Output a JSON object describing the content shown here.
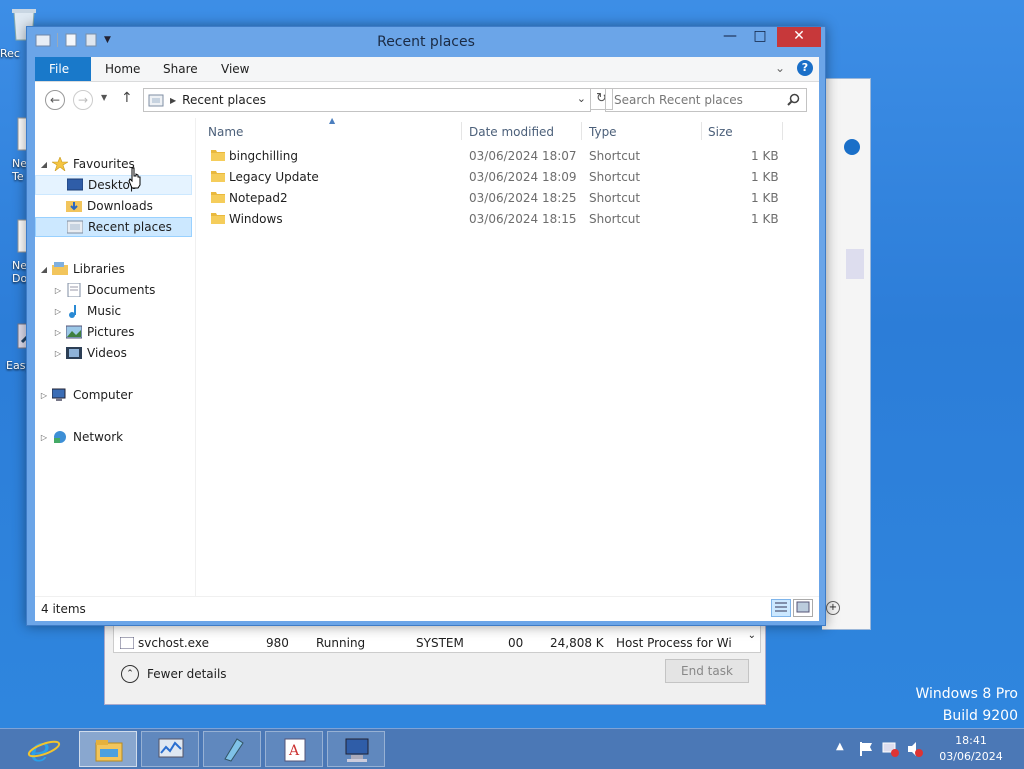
{
  "desktop": {
    "icons": [
      {
        "label": "Rec",
        "icon": "recycle-bin-icon"
      },
      {
        "label": "Ne\nTe",
        "icon": "text-document-icon"
      },
      {
        "label": "Ne\nDo",
        "icon": "document-icon"
      },
      {
        "label": "Easy",
        "icon": "shortcut-icon"
      }
    ],
    "watermark": {
      "line1": "Windows 8 Pro",
      "line2": "Build 9200"
    }
  },
  "task_manager": {
    "rows": [
      {
        "name": "svchost.exe",
        "pid": "980",
        "status": "Running",
        "user": "SYSTEM",
        "cpu": "00",
        "memory": "24,808 K",
        "description": "Host Process for Wi"
      }
    ],
    "fewer_details": "Fewer details",
    "end_task": "End task"
  },
  "explorer": {
    "title": "Recent places",
    "ribbon_tabs": [
      "File",
      "Home",
      "Share",
      "View"
    ],
    "address": "Recent places",
    "search_placeholder": "Search Recent places",
    "nav": {
      "favourites": "Favourites",
      "desktop": "Desktop",
      "downloads": "Downloads",
      "recent_places": "Recent places",
      "libraries": "Libraries",
      "documents": "Documents",
      "music": "Music",
      "pictures": "Pictures",
      "videos": "Videos",
      "computer": "Computer",
      "network": "Network"
    },
    "columns": {
      "name": "Name",
      "date": "Date modified",
      "type": "Type",
      "size": "Size"
    },
    "files": [
      {
        "name": "bingchilling",
        "date": "03/06/2024 18:07",
        "type": "Shortcut",
        "size": "1 KB"
      },
      {
        "name": "Legacy Update",
        "date": "03/06/2024 18:09",
        "type": "Shortcut",
        "size": "1 KB"
      },
      {
        "name": "Notepad2",
        "date": "03/06/2024 18:25",
        "type": "Shortcut",
        "size": "1 KB"
      },
      {
        "name": "Windows",
        "date": "03/06/2024 18:15",
        "type": "Shortcut",
        "size": "1 KB"
      }
    ],
    "status": "4 items"
  },
  "taskbar": {
    "buttons": [
      "internet-explorer-icon",
      "file-explorer-icon",
      "performance-monitor-icon",
      "notepad-icon",
      "wordpad-icon",
      "remote-desktop-icon"
    ],
    "time": "18:41",
    "date": "03/06/2024"
  },
  "colors": {
    "accent": "#1979ca",
    "selection": "#cce8ff",
    "close": "#c7383a"
  }
}
